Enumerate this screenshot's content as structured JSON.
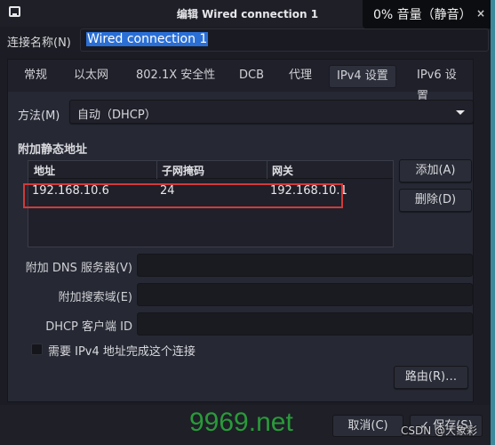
{
  "window": {
    "title": "编辑 Wired connection 1",
    "icon": "network-wired-icon",
    "close_glyph": "×"
  },
  "volume_osd": {
    "text": "0% 音量（静音）"
  },
  "connection": {
    "label": "连接名称(N)",
    "value": "Wired connection 1"
  },
  "tabs": [
    {
      "label": "常规",
      "active": false
    },
    {
      "label": "以太网",
      "active": false
    },
    {
      "label": "802.1X 安全性",
      "active": false
    },
    {
      "label": "DCB",
      "active": false
    },
    {
      "label": "代理",
      "active": false
    },
    {
      "label": "IPv4 设置",
      "active": true
    },
    {
      "label": "IPv6 设置",
      "active": false
    }
  ],
  "ipv4": {
    "method_label": "方法(M)",
    "method_value": "自动（DHCP）",
    "static_section_title": "附加静态地址",
    "columns": [
      "地址",
      "子网掩码",
      "网关"
    ],
    "rows": [
      {
        "address": "192.168.10.6",
        "netmask": "24",
        "gateway": "192.168.10.1"
      }
    ],
    "add_button": "添加(A)",
    "delete_button": "删除(D)",
    "dns_label": "附加 DNS 服务器(V)",
    "dns_value": "",
    "search_label": "附加搜索域(E)",
    "search_value": "",
    "dhcp_id_label": "DHCP 客户端 ID",
    "dhcp_id_value": "",
    "require_ipv4_label": "需要 IPv4 地址完成这个连接",
    "require_ipv4_checked": false,
    "routes_button": "路由(R)…"
  },
  "footer": {
    "cancel_button": "取消(C)",
    "save_button": "✓ 保存(S)",
    "watermark_site": "9969.net",
    "watermark_csdn": "CSDN @大象彩"
  },
  "colors": {
    "selection": "#2a6fd6",
    "highlight_box": "#d03a3a",
    "watermark_green": "#2a9a3a"
  }
}
